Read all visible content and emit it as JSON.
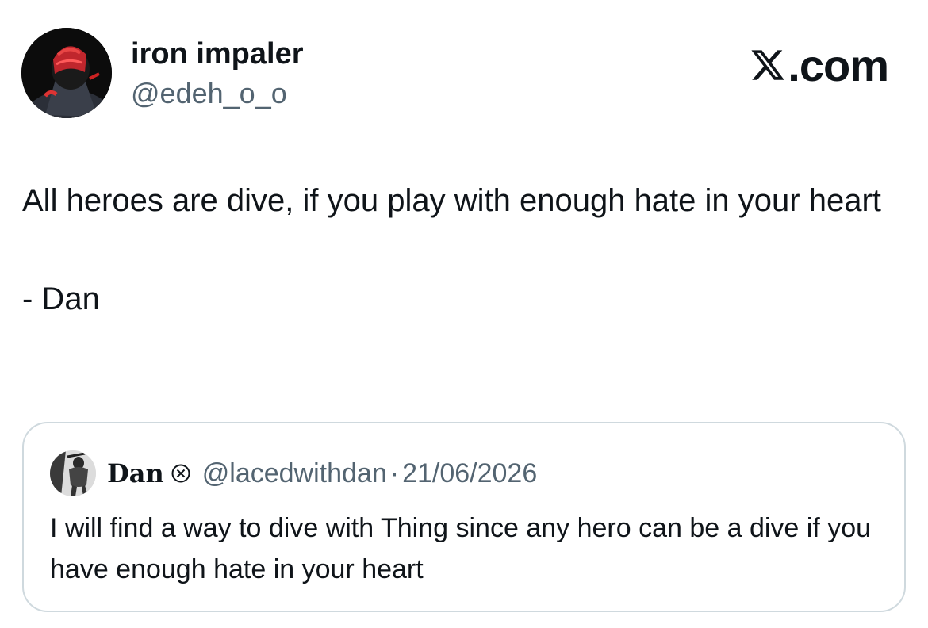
{
  "tweet": {
    "author": {
      "display_name": "iron impaler",
      "handle": "@edeh_o_o",
      "avatar_icon": "avatar-dark-hooded-figure"
    },
    "brand": {
      "text": ".com",
      "icon": "x-logo-icon"
    },
    "body": {
      "line1": "All heroes are dive, if you play with enough hate in your heart",
      "line2": "- Dan"
    },
    "quoted": {
      "display_name": "Dan",
      "badge_icon": "circled-x-icon",
      "handle": "@lacedwithdan",
      "separator": "·",
      "date": "21/06/2026",
      "text": "I will find a way to dive with Thing since any hero can be a dive if you have enough hate in your heart",
      "avatar_icon": "avatar-statue-figure"
    }
  },
  "colors": {
    "text": "#0f1419",
    "secondary": "#536471",
    "border": "#cfd9de",
    "background": "#ffffff"
  }
}
